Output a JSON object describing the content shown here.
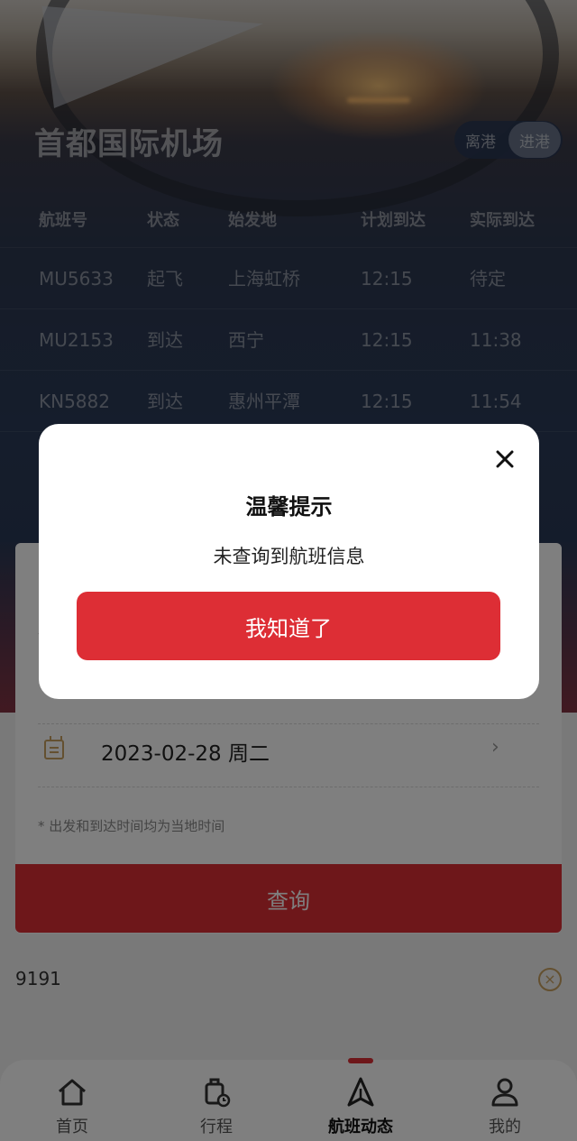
{
  "header": {
    "airport_name": "首都国际机场",
    "toggle": {
      "departure_label": "离港",
      "arrival_label": "进港",
      "selected": "进港"
    }
  },
  "flight_table": {
    "columns": [
      "航班号",
      "状态",
      "始发地",
      "计划到达",
      "实际到达"
    ],
    "rows": [
      [
        "MU5633",
        "起飞",
        "上海虹桥",
        "12:15",
        "待定"
      ],
      [
        "MU2153",
        "到达",
        "西宁",
        "12:15",
        "11:38"
      ],
      [
        "KN5882",
        "到达",
        "惠州平潭",
        "12:15",
        "11:54"
      ]
    ]
  },
  "search_form": {
    "date_value": "2023-02-28 周二",
    "note": "* 出发和到达时间均为当地时间",
    "query_button_label": "查询",
    "history_value": "9191"
  },
  "tabbar": {
    "items": [
      {
        "label": "首页",
        "icon": "home-icon"
      },
      {
        "label": "行程",
        "icon": "luggage-icon"
      },
      {
        "label": "航班动态",
        "icon": "plane-icon"
      },
      {
        "label": "我的",
        "icon": "user-icon"
      }
    ],
    "active": "航班动态",
    "accent_color": "#dd2e35"
  },
  "dialog": {
    "title": "温馨提示",
    "message": "未查询到航班信息",
    "confirm_label": "我知道了"
  }
}
